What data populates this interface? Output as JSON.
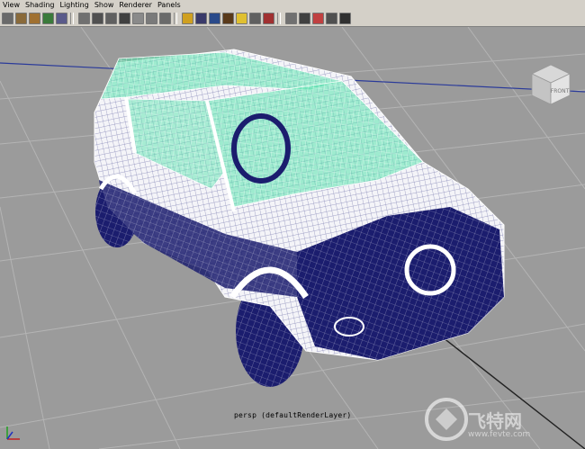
{
  "menu": {
    "items": [
      "View",
      "Shading",
      "Lighting",
      "Show",
      "Renderer",
      "Panels"
    ]
  },
  "toolbar": {
    "buttons": [
      {
        "icon": "select-camera-icon",
        "color": "#6a6a6a"
      },
      {
        "icon": "lock-camera-icon",
        "color": "#8a6a3a"
      },
      {
        "icon": "camera-attributes-icon",
        "color": "#a07030"
      },
      {
        "icon": "bookmark-icon",
        "color": "#3a7a3a"
      },
      {
        "icon": "image-plane-icon",
        "color": "#5a5a8a"
      },
      {
        "icon": "grid-icon",
        "color": "#707070"
      },
      {
        "icon": "film-gate-icon",
        "color": "#505050"
      },
      {
        "icon": "resolution-gate-icon",
        "color": "#606060"
      },
      {
        "icon": "gate-mask-icon",
        "color": "#404040"
      },
      {
        "icon": "field-chart-icon",
        "color": "#8a8a8a"
      },
      {
        "icon": "safe-action-icon",
        "color": "#7a7a7a"
      },
      {
        "icon": "safe-title-icon",
        "color": "#6a6a6a"
      },
      {
        "icon": "wireframe-icon",
        "color": "#d0a020"
      },
      {
        "icon": "smooth-shade-icon",
        "color": "#3a3a6a"
      },
      {
        "icon": "wireframe-on-shaded-icon",
        "color": "#2a4a8a"
      },
      {
        "icon": "textured-icon",
        "color": "#5a3a1a"
      },
      {
        "icon": "lighting-icon",
        "color": "#e0c030"
      },
      {
        "icon": "shadows-icon",
        "color": "#606060"
      },
      {
        "icon": "xray-icon",
        "color": "#a03030"
      },
      {
        "icon": "xray-joints-icon",
        "color": "#707070"
      },
      {
        "icon": "xray-components-icon",
        "color": "#404040"
      },
      {
        "icon": "isolate-select-icon",
        "color": "#c04040"
      },
      {
        "icon": "high-quality-icon",
        "color": "#505050"
      },
      {
        "icon": "resolution-icon",
        "color": "#303030"
      }
    ]
  },
  "viewport": {
    "camera_label": "persp (defaultRenderLayer)",
    "viewcube_label": "FRONT",
    "grid_color": "#9b9b9b",
    "mesh_colors": {
      "body_dark": "#1b1d6e",
      "body_wire": "#ffffff",
      "glass_wire": "#3ee0a0"
    }
  },
  "watermark": {
    "text": "飞特网",
    "url": "www.fevte.com"
  }
}
